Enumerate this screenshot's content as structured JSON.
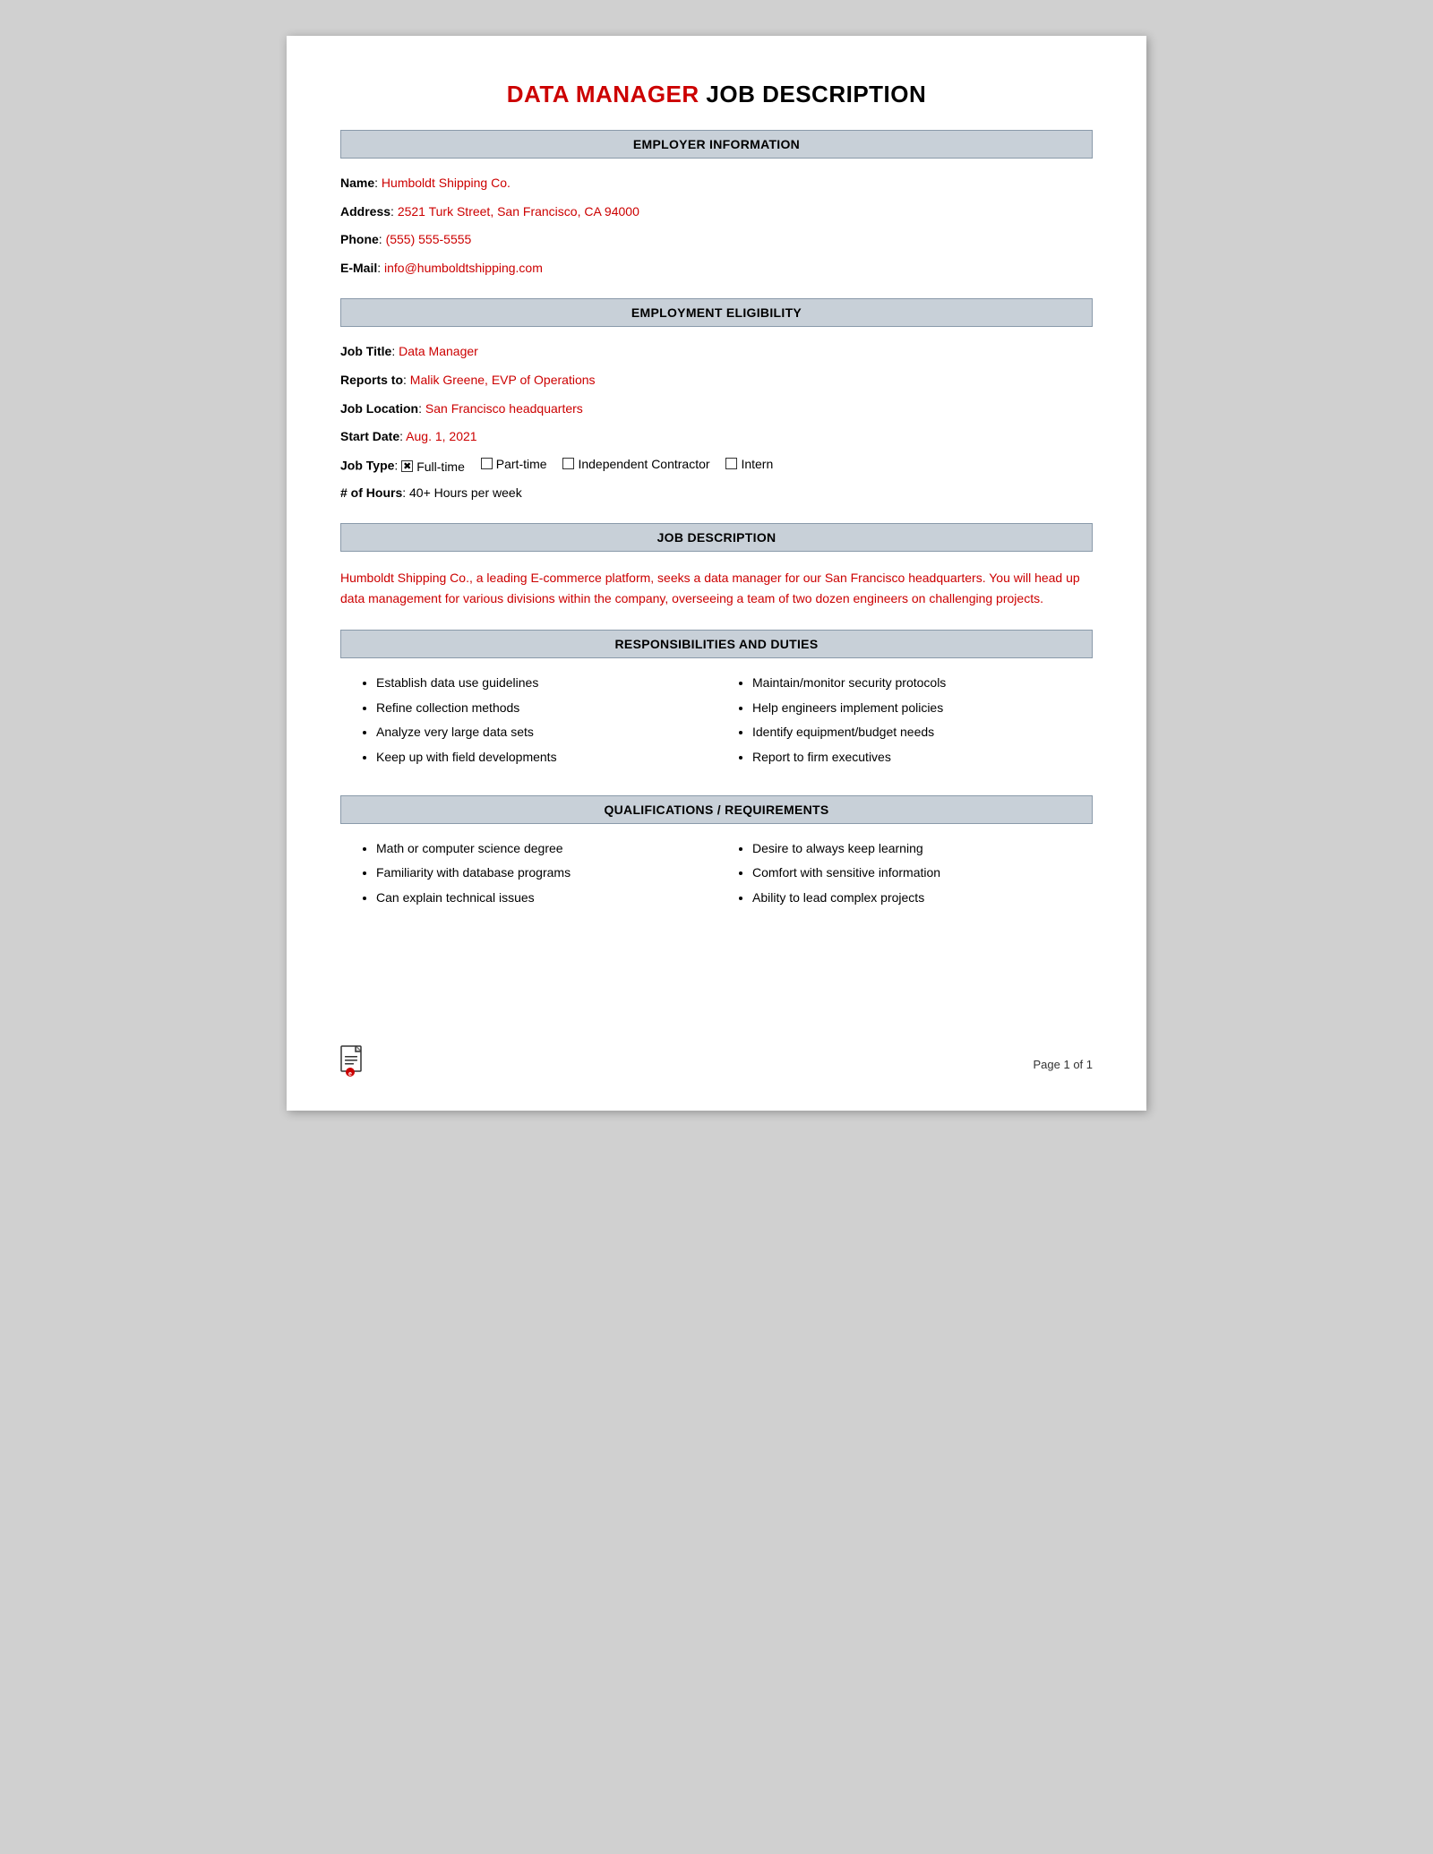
{
  "title": {
    "red": "DATA MANAGER",
    "black": " JOB DESCRIPTION"
  },
  "sections": {
    "employer_info": {
      "header": "EMPLOYER INFORMATION",
      "fields": [
        {
          "label": "Name",
          "value": "Humboldt Shipping Co."
        },
        {
          "label": "Address",
          "value": "2521 Turk Street, San Francisco, CA 94000"
        },
        {
          "label": "Phone",
          "value": "(555) 555-5555"
        },
        {
          "label": "E-Mail",
          "value": "info@humboldtshipping.com"
        }
      ]
    },
    "employment_eligibility": {
      "header": "EMPLOYMENT ELIGIBILITY",
      "fields": [
        {
          "label": "Job Title",
          "value": "Data Manager"
        },
        {
          "label": "Reports to",
          "value": "Malik Greene, EVP of Operations"
        },
        {
          "label": "Job Location",
          "value": "San Francisco headquarters"
        },
        {
          "label": "Start Date",
          "value": "Aug. 1, 2021"
        }
      ],
      "job_type_label": "Job Type",
      "job_types": [
        {
          "label": "Full-time",
          "checked": true
        },
        {
          "label": "Part-time",
          "checked": false
        },
        {
          "label": "Independent Contractor",
          "checked": false
        },
        {
          "label": "Intern",
          "checked": false
        }
      ],
      "hours_label": "# of Hours",
      "hours_value": "40+ Hours per week"
    },
    "job_description": {
      "header": "JOB DESCRIPTION",
      "text": "Humboldt Shipping Co., a leading E-commerce platform, seeks a data manager for our San Francisco headquarters. You will head up data management for various divisions within the company, overseeing a team of two dozen engineers on challenging projects."
    },
    "responsibilities": {
      "header": "RESPONSIBILITIES AND DUTIES",
      "col1": [
        "Establish data use guidelines",
        "Refine collection methods",
        "Analyze very large data sets",
        "Keep up with field developments"
      ],
      "col2": [
        "Maintain/monitor security protocols",
        "Help engineers implement policies",
        "Identify equipment/budget needs",
        "Report to firm executives"
      ]
    },
    "qualifications": {
      "header": "QUALIFICATIONS / REQUIREMENTS",
      "col1": [
        "Math or computer science degree",
        "Familiarity with database programs",
        "Can explain technical issues"
      ],
      "col2": [
        "Desire to always keep learning",
        "Comfort with sensitive information",
        "Ability to lead complex projects"
      ]
    }
  },
  "footer": {
    "page_label": "Page 1 of 1"
  }
}
